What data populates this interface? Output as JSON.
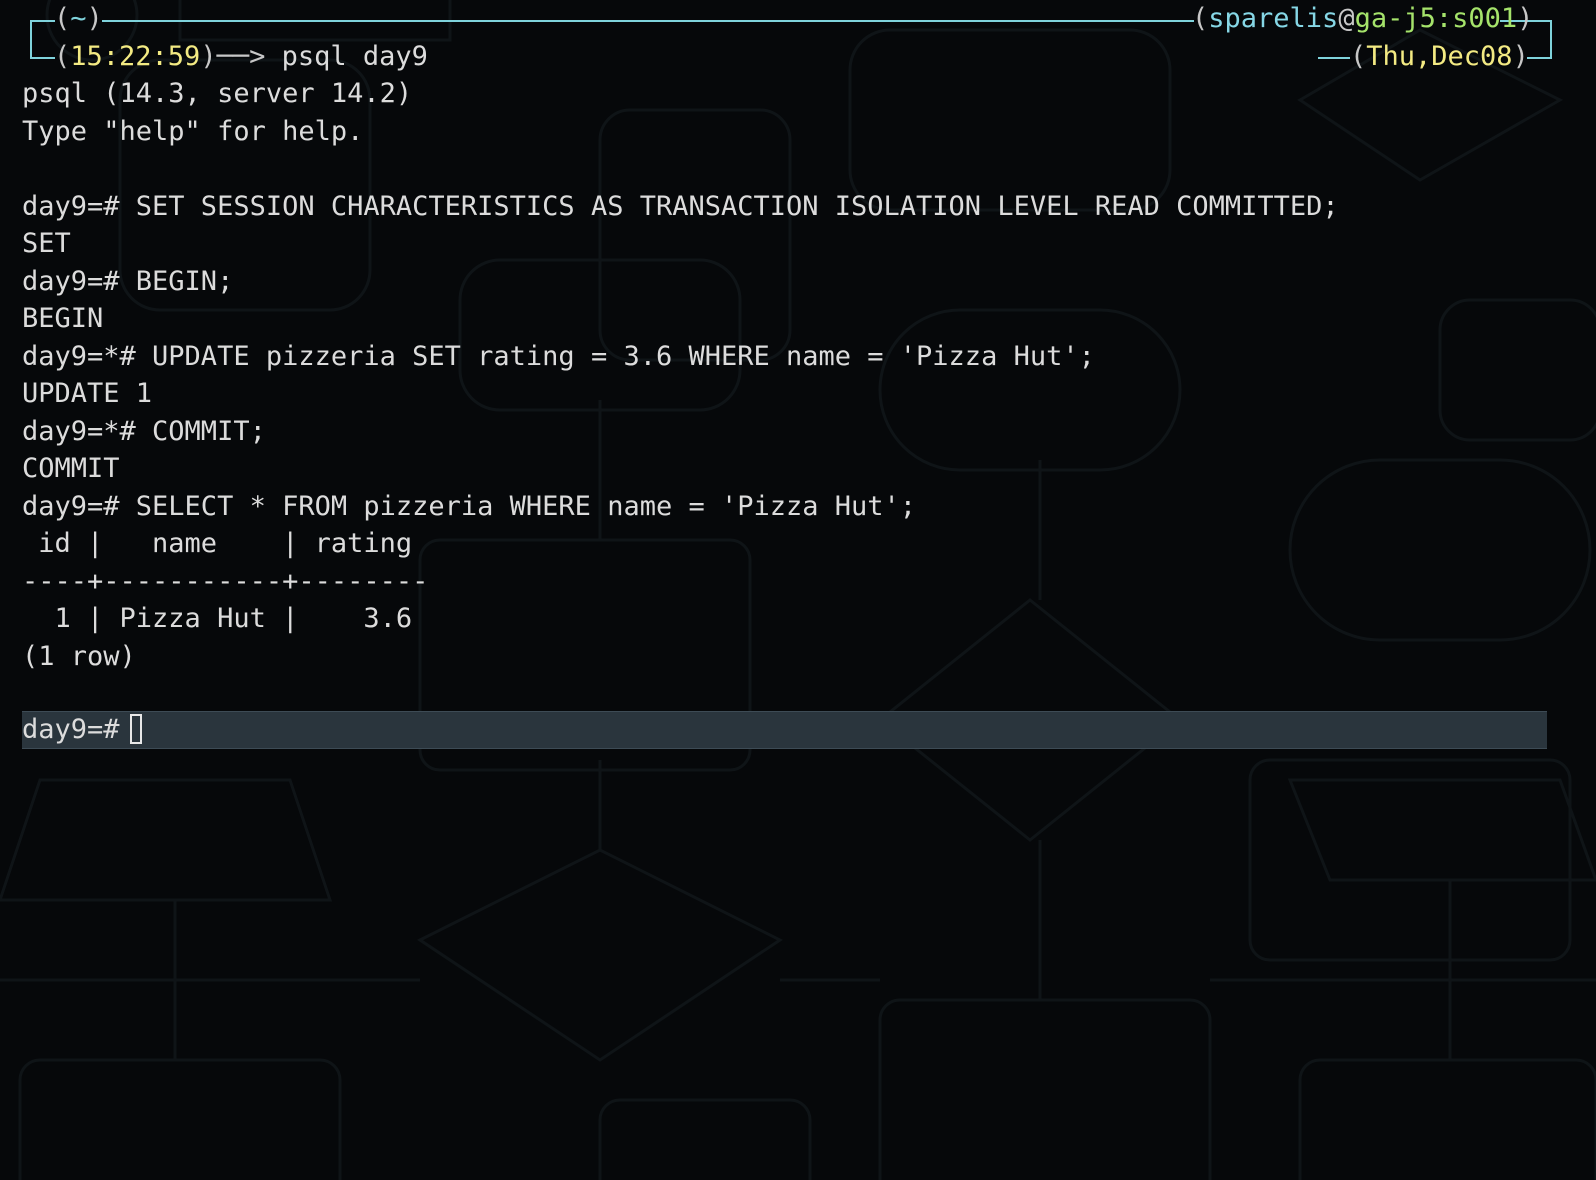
{
  "prompt_header": {
    "cwd": "~",
    "time": "15:22:59",
    "command": "psql day9",
    "user": "sparelis",
    "at_sign": "@",
    "host": "ga-j5:s001",
    "date": "Thu,Dec08"
  },
  "output_lines": [
    "psql (14.3, server 14.2)",
    "Type \"help\" for help.",
    "",
    "day9=# SET SESSION CHARACTERISTICS AS TRANSACTION ISOLATION LEVEL READ COMMITTED;",
    "SET",
    "day9=# BEGIN;",
    "BEGIN",
    "day9=*# UPDATE pizzeria SET rating = 3.6 WHERE name = 'Pizza Hut';",
    "UPDATE 1",
    "day9=*# COMMIT;",
    "COMMIT",
    "day9=# SELECT * FROM pizzeria WHERE name = 'Pizza Hut';",
    " id |   name    | rating",
    "----+-----------+--------",
    "  1 | Pizza Hut |    3.6",
    "(1 row)",
    ""
  ],
  "current_prompt": "day9=#",
  "colors": {
    "background": "#06080a",
    "frame": "#7fd3dc",
    "time": "#f3ea83",
    "user": "#86d7e6",
    "host": "#a5e36b",
    "highlight_line": "#2a353d"
  }
}
